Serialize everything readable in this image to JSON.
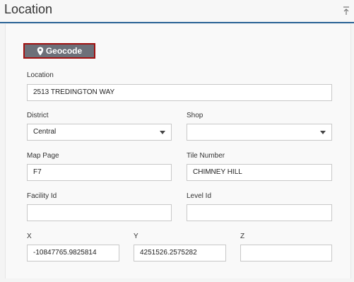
{
  "header": {
    "title": "Location"
  },
  "geocode": {
    "label": "Geocode"
  },
  "fields": {
    "location": {
      "label": "Location",
      "value": "2513 TREDINGTON WAY"
    },
    "district": {
      "label": "District",
      "value": "Central"
    },
    "shop": {
      "label": "Shop",
      "value": ""
    },
    "map_page": {
      "label": "Map Page",
      "value": "F7"
    },
    "tile_number": {
      "label": "Tile Number",
      "value": "CHIMNEY HILL"
    },
    "facility_id": {
      "label": "Facility Id",
      "value": ""
    },
    "level_id": {
      "label": "Level Id",
      "value": ""
    },
    "x": {
      "label": "X",
      "value": "-10847765.9825814"
    },
    "y": {
      "label": "Y",
      "value": "4251526.2575282"
    },
    "z": {
      "label": "Z",
      "value": ""
    }
  },
  "icons": {
    "collapse": "collapse-up-icon",
    "geocode": "map-pin-icon",
    "dropdown": "chevron-down-icon"
  },
  "colors": {
    "accent": "#2a6496",
    "button_bg": "#6d7079",
    "button_border": "#a01010"
  }
}
